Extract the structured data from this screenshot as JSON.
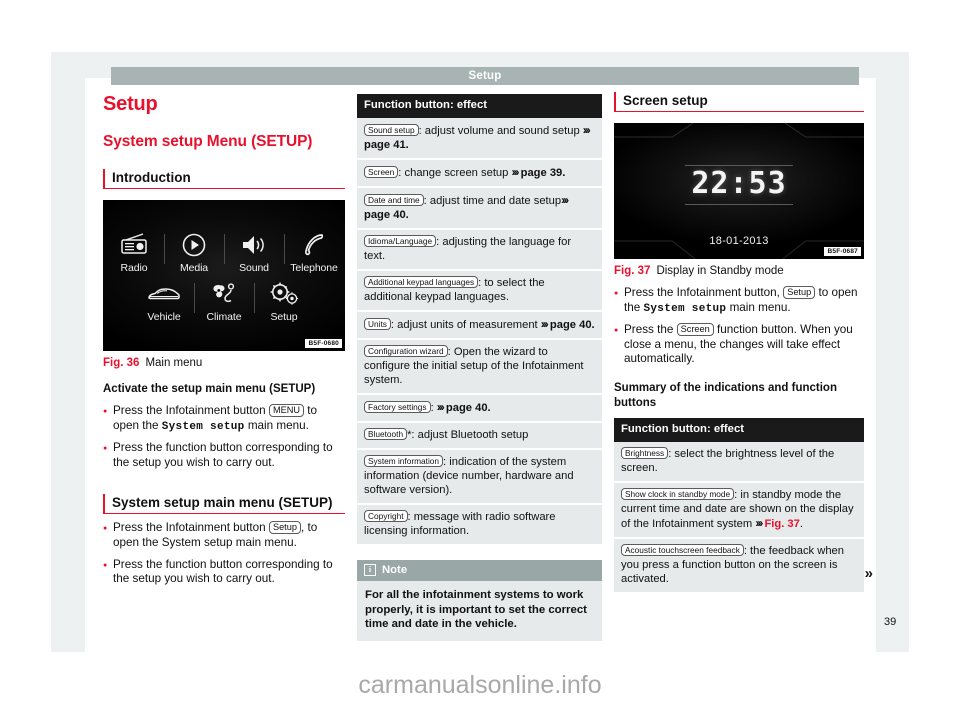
{
  "header": {
    "title": "Setup"
  },
  "page_number": "39",
  "watermark": "carmanualsonline.info",
  "left": {
    "title": "Setup",
    "subtitle": "System setup Menu (SETUP)",
    "section_intro": "Introduction",
    "figure": {
      "caption_number": "Fig. 36",
      "caption_text": "Main menu",
      "code": "B5F-0680",
      "menu_row1": [
        {
          "label": "Radio",
          "icon": "radio-icon"
        },
        {
          "label": "Media",
          "icon": "play-circle-icon"
        },
        {
          "label": "Sound",
          "icon": "speaker-icon"
        },
        {
          "label": "Telephone",
          "icon": "phone-handset-icon"
        }
      ],
      "menu_row2": [
        {
          "label": "Vehicle",
          "icon": "car-icon"
        },
        {
          "label": "Climate",
          "icon": "climate-fan-icon"
        },
        {
          "label": "Setup",
          "icon": "gears-icon"
        }
      ]
    },
    "activate_heading": "Activate the setup main menu (SETUP)",
    "bullet_1_pre": "Press the Infotainment button ",
    "bullet_1_key": "MENU",
    "bullet_1_mid": " to open the ",
    "bullet_1_mono": "System setup",
    "bullet_1_post": " main menu.",
    "bullet_2": "Press the function button corresponding to the setup you wish to carry out.",
    "section_setup_menu": "System setup main menu (SETUP)",
    "bullet_3_pre": "Press the Infotainment button ",
    "bullet_3_key": "Setup",
    "bullet_3_post": ", to open the System setup main menu.",
    "bullet_4": "Press the function button corresponding to the setup you wish to carry out."
  },
  "middle": {
    "table_header": "Function button: effect",
    "rows": [
      {
        "button": "Sound setup",
        "text": ": adjust volume and sound setup ",
        "ref": "page 41.",
        "has_arrow": true
      },
      {
        "button": "Screen",
        "text": ": change screen setup ",
        "ref": "page 39.",
        "has_arrow": true
      },
      {
        "button": "Date and time",
        "text": ": adjust time and date setup",
        "ref": "page 40.",
        "has_arrow": true
      },
      {
        "button": "Idioma/Language",
        "text": ": adjusting the language for text.",
        "ref": "",
        "has_arrow": false
      },
      {
        "button": "Additional keypad languages",
        "text": ": to select the additional keypad languages.",
        "ref": "",
        "has_arrow": false
      },
      {
        "button": "Units",
        "text": ": adjust units of measurement ",
        "ref": "page 40.",
        "has_arrow": true
      },
      {
        "button": "Configuration wizard",
        "text": ": Open the wizard to configure the initial setup of the Infotainment system.",
        "ref": "",
        "has_arrow": false
      },
      {
        "button": "Factory settings",
        "text": ": ",
        "ref": "page 40.",
        "has_arrow": true
      },
      {
        "button": "Bluetooth",
        "text": "*: adjust Bluetooth setup",
        "ref": "",
        "has_arrow": false
      },
      {
        "button": "System information",
        "text": ": indication of the system information (device number, hardware and software version).",
        "ref": "",
        "has_arrow": false
      },
      {
        "button": "Copyright",
        "text": ": message with radio software licensing information.",
        "ref": "",
        "has_arrow": false
      }
    ],
    "note": {
      "icon": "info-icon",
      "title": "Note",
      "body": "For all the infotainment systems to work properly, it is important to set the correct time and date in the vehicle."
    }
  },
  "right": {
    "section_screen_setup": "Screen setup",
    "figure": {
      "caption_number": "Fig. 37",
      "caption_text": "Display in Standby mode",
      "code": "B5F-0687",
      "clock": "22:53",
      "date": "18-01-2013"
    },
    "bullet_1_pre": "Press the Infotainment button, ",
    "bullet_1_key": "Setup",
    "bullet_1_mid": " to open the ",
    "bullet_1_mono": "System setup",
    "bullet_1_post": " main menu.",
    "bullet_2_pre": "Press the ",
    "bullet_2_key": "Screen",
    "bullet_2_post": " function button. When you close a menu, the changes will take effect automatically.",
    "summary_heading": "Summary of the indications and function buttons",
    "table_header": "Function button: effect",
    "rows": [
      {
        "button": "Brightness",
        "text": ": select the brightness level of the screen.",
        "ref": "",
        "has_arrow": false
      },
      {
        "button": "Show clock in standby mode",
        "text": ": in standby mode the current time and date are shown on the display of the Infotainment system ",
        "ref": "Fig. 37",
        "ref_suffix": ".",
        "has_arrow": true
      },
      {
        "button": "Acoustic touchscreen feedback",
        "text": ": the feedback when you press a function button on the screen is activated.",
        "ref": "",
        "has_arrow": false
      }
    ],
    "continue_marker": "»"
  },
  "colors": {
    "accent_red": "#e8112d",
    "header_gray": "#a8b4b4",
    "table_header_black": "#1a1a1a",
    "row_gray": "#e6eaea",
    "note_head_gray": "#9aa7a7",
    "page_gray": "#edf1f1"
  }
}
